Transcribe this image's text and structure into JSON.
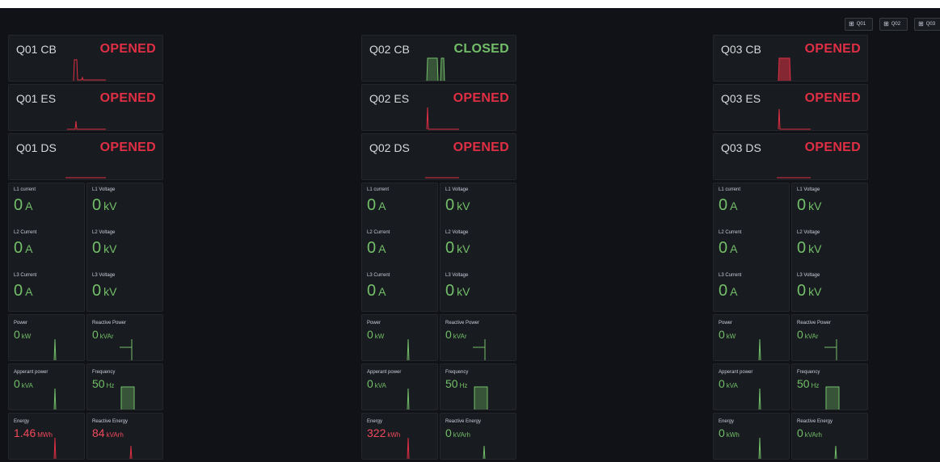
{
  "nav_buttons": [
    {
      "label": "Q01",
      "icon": "grid-icon"
    },
    {
      "label": "Q02",
      "icon": "grid-icon"
    },
    {
      "label": "Q03",
      "icon": "grid-icon"
    }
  ],
  "colors": {
    "background": "#111217",
    "panel": "#181b1f",
    "red": "#e02f44",
    "green": "#73bf69"
  },
  "bays": [
    {
      "status": [
        {
          "title": "Q01 CB",
          "value": "OPENED",
          "state": "red"
        },
        {
          "title": "Q01 ES",
          "value": "OPENED",
          "state": "red"
        },
        {
          "title": "Q01 DS",
          "value": "OPENED",
          "state": "red"
        }
      ],
      "measure": {
        "l1_current": {
          "label": "L1 current",
          "value": "0",
          "unit": "A"
        },
        "l1_voltage": {
          "label": "L1 Voltage",
          "value": "0",
          "unit": "kV"
        },
        "l2_current": {
          "label": "L2 Current",
          "value": "0",
          "unit": "A"
        },
        "l2_voltage": {
          "label": "L2 Voltage",
          "value": "0",
          "unit": "kV"
        },
        "l3_current": {
          "label": "L3 Current",
          "value": "0",
          "unit": "A"
        },
        "l3_voltage": {
          "label": "L3 Voltage",
          "value": "0",
          "unit": "kV"
        }
      },
      "metrics": [
        {
          "label": "Power",
          "value": "0",
          "unit": "kW",
          "state": "green"
        },
        {
          "label": "Reactive Power",
          "value": "0",
          "unit": "kVAr",
          "state": "green"
        },
        {
          "label": "Apperant power",
          "value": "0",
          "unit": "kVA",
          "state": "green"
        },
        {
          "label": "Frequency",
          "value": "50",
          "unit": "Hz",
          "state": "green"
        },
        {
          "label": "Energy",
          "value": "1.46",
          "unit": "MWh",
          "state": "red"
        },
        {
          "label": "Reactive Energy",
          "value": "84",
          "unit": "kVArh",
          "state": "red"
        }
      ]
    },
    {
      "status": [
        {
          "title": "Q02 CB",
          "value": "CLOSED",
          "state": "green"
        },
        {
          "title": "Q02 ES",
          "value": "OPENED",
          "state": "red"
        },
        {
          "title": "Q02 DS",
          "value": "OPENED",
          "state": "red"
        }
      ],
      "measure": {
        "l1_current": {
          "label": "L1 current",
          "value": "0",
          "unit": "A"
        },
        "l1_voltage": {
          "label": "L1 Voltage",
          "value": "0",
          "unit": "kV"
        },
        "l2_current": {
          "label": "L2 Current",
          "value": "0",
          "unit": "A"
        },
        "l2_voltage": {
          "label": "L2 Voltage",
          "value": "0",
          "unit": "kV"
        },
        "l3_current": {
          "label": "L3 Current",
          "value": "0",
          "unit": "A"
        },
        "l3_voltage": {
          "label": "L3 Voltage",
          "value": "0",
          "unit": "kV"
        }
      },
      "metrics": [
        {
          "label": "Power",
          "value": "0",
          "unit": "kW",
          "state": "green"
        },
        {
          "label": "Reactive Power",
          "value": "0",
          "unit": "kVAr",
          "state": "green"
        },
        {
          "label": "Apperant power",
          "value": "0",
          "unit": "kVA",
          "state": "green"
        },
        {
          "label": "Frequency",
          "value": "50",
          "unit": "Hz",
          "state": "green"
        },
        {
          "label": "Energy",
          "value": "322",
          "unit": "kWh",
          "state": "red"
        },
        {
          "label": "Reactive Energy",
          "value": "0",
          "unit": "kVArh",
          "state": "green"
        }
      ]
    },
    {
      "status": [
        {
          "title": "Q03 CB",
          "value": "OPENED",
          "state": "red"
        },
        {
          "title": "Q03 ES",
          "value": "OPENED",
          "state": "red"
        },
        {
          "title": "Q03 DS",
          "value": "OPENED",
          "state": "red"
        }
      ],
      "measure": {
        "l1_current": {
          "label": "L1 current",
          "value": "0",
          "unit": "A"
        },
        "l1_voltage": {
          "label": "L1 Voltage",
          "value": "0",
          "unit": "kV"
        },
        "l2_current": {
          "label": "L2 Current",
          "value": "0",
          "unit": "A"
        },
        "l2_voltage": {
          "label": "L2 Voltage",
          "value": "0",
          "unit": "kV"
        },
        "l3_current": {
          "label": "L3 Current",
          "value": "0",
          "unit": "A"
        },
        "l3_voltage": {
          "label": "L3 Voltage",
          "value": "0",
          "unit": "kV"
        }
      },
      "metrics": [
        {
          "label": "Power",
          "value": "0",
          "unit": "kW",
          "state": "green"
        },
        {
          "label": "Reactive Power",
          "value": "0",
          "unit": "kVAr",
          "state": "green"
        },
        {
          "label": "Apperant power",
          "value": "0",
          "unit": "kVA",
          "state": "green"
        },
        {
          "label": "Frequency",
          "value": "50",
          "unit": "Hz",
          "state": "green"
        },
        {
          "label": "Energy",
          "value": "0",
          "unit": "kWh",
          "state": "green"
        },
        {
          "label": "Reactive Energy",
          "value": "0",
          "unit": "kVArh",
          "state": "green"
        }
      ]
    }
  ]
}
